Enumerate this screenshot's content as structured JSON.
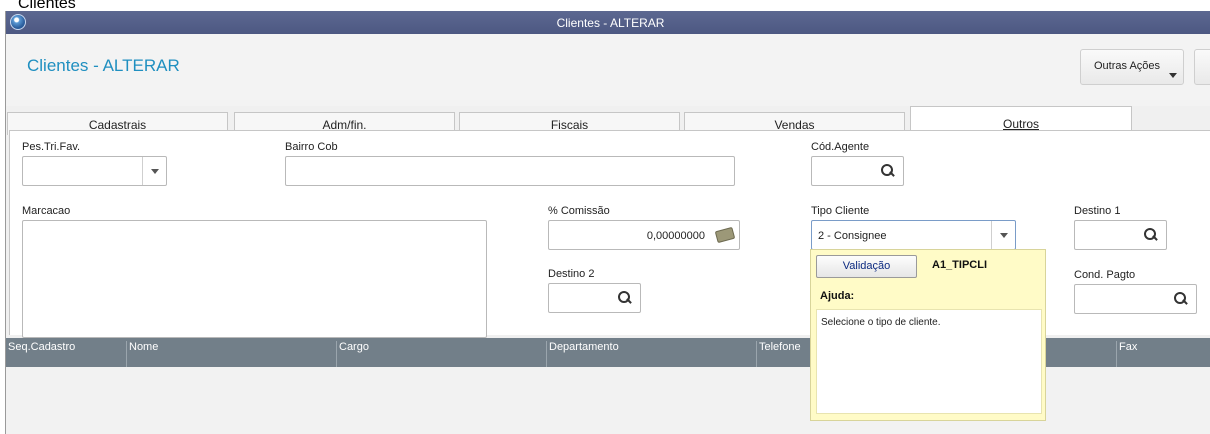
{
  "background_title": "Clientes",
  "window": {
    "title": "Clientes - ALTERAR"
  },
  "header": {
    "page_title": "Clientes - ALTERAR",
    "outras_acoes_label": "Outras Ações"
  },
  "tabs": [
    {
      "label": "Cadastrais",
      "active": false
    },
    {
      "label": "Adm/fin.",
      "active": false
    },
    {
      "label": "Fiscais",
      "active": false
    },
    {
      "label": "Vendas",
      "active": false
    },
    {
      "label": "Outros",
      "active": true
    }
  ],
  "form": {
    "pes_tri_fav": {
      "label": "Pes.Tri.Fav.",
      "value": ""
    },
    "bairro_cob": {
      "label": "Bairro Cob",
      "value": ""
    },
    "cod_agente": {
      "label": "Cód.Agente",
      "value": ""
    },
    "marcacao": {
      "label": "Marcacao",
      "value": ""
    },
    "comissao": {
      "label": "% Comissão",
      "value": "0,00000000"
    },
    "tipo_cliente": {
      "label": "Tipo Cliente",
      "value": "2 - Consignee"
    },
    "destino1": {
      "label": "Destino 1",
      "value": ""
    },
    "destino2": {
      "label": "Destino 2",
      "value": ""
    },
    "cond_pagto": {
      "label": "Cond. Pagto",
      "value": ""
    }
  },
  "grid": {
    "columns": [
      "Seq.Cadastro",
      "Nome",
      "Cargo",
      "Departamento",
      "Telefone",
      "",
      "Fax"
    ]
  },
  "popup": {
    "validacao_label": "Validação",
    "field_name": "A1_TIPCLI",
    "ajuda_label": "Ajuda:",
    "help_text": "Selecione o tipo de cliente."
  },
  "colors": {
    "titlebar": "#5c6891",
    "accent": "#1f8fc0",
    "grid_header": "#727f89",
    "popup_bg": "#fffbc7"
  }
}
